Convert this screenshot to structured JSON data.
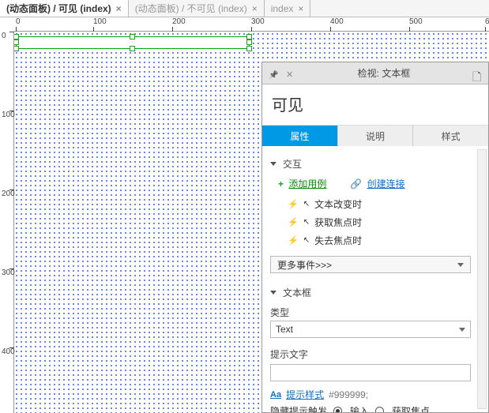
{
  "tabs": [
    {
      "label": "(动态面板) / 可见 (index)",
      "active": true
    },
    {
      "label": "(动态面板) / 不可见 (index)",
      "active": false
    },
    {
      "label": "index",
      "active": false
    }
  ],
  "ruler_h": [
    "0",
    "100",
    "200",
    "300",
    "400",
    "500",
    "6"
  ],
  "ruler_v": [
    "0",
    "100",
    "200",
    "300",
    "400"
  ],
  "inspector": {
    "title": "检视: 文本框",
    "widget_name": "可见",
    "subtabs": {
      "properties": "属性",
      "notes": "说明",
      "style": "样式"
    },
    "sections": {
      "interactions": {
        "title": "交互",
        "add_case": "添加用例",
        "create_link": "创建连接",
        "events": [
          "文本改变时",
          "获取焦点时",
          "失去焦点时"
        ],
        "more": "更多事件>>>"
      },
      "textfield": {
        "title": "文本框",
        "type_label": "类型",
        "type_value": "Text",
        "hint_label": "提示文字",
        "hint_value": "",
        "hint_style_link": "提示样式",
        "hint_style_hex": "#999999;",
        "trigger_label": "隐藏提示触发",
        "trigger_input": "输入",
        "trigger_focus": "获取焦点"
      }
    }
  }
}
